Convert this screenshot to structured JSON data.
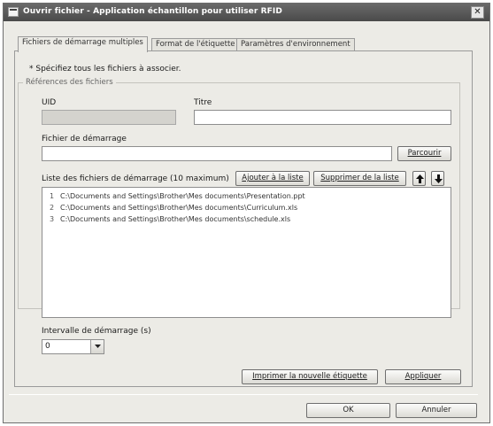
{
  "window": {
    "title": "Ouvrir fichier - Application échantillon pour utiliser RFID",
    "close_glyph": "✕"
  },
  "tabs": [
    {
      "label": "Fichiers de démarrage multiples",
      "active": true
    },
    {
      "label": "Format de l'étiquette",
      "active": false
    },
    {
      "label": "Paramètres d'environnement",
      "active": false
    }
  ],
  "form": {
    "instruction": "* Spécifiez tous les fichiers à associer.",
    "group_label": "Références des fichiers",
    "uid_label": "UID",
    "uid_value": "",
    "title_label": "Titre",
    "title_value": "",
    "startup_file_label": "Fichier de démarrage",
    "startup_file_value": "",
    "browse_button": "Parcourir",
    "list_label": "Liste des fichiers de démarrage (10 maximum)",
    "add_button": "Ajouter à la liste",
    "remove_button": "Supprimer de la liste",
    "files": [
      {
        "index": "1",
        "path": "C:\\Documents and Settings\\Brother\\Mes documents\\Presentation.ppt"
      },
      {
        "index": "2",
        "path": "C:\\Documents and Settings\\Brother\\Mes documents\\Curriculum.xls"
      },
      {
        "index": "3",
        "path": "C:\\Documents and Settings\\Brother\\Mes documents\\schedule.xls"
      }
    ],
    "interval_label": "Intervalle de démarrage (s)",
    "interval_value": "0",
    "print_button": "Imprimer la nouvelle étiquette",
    "apply_button": "Appliquer"
  },
  "footer": {
    "ok_button": "OK",
    "cancel_button": "Annuler"
  }
}
